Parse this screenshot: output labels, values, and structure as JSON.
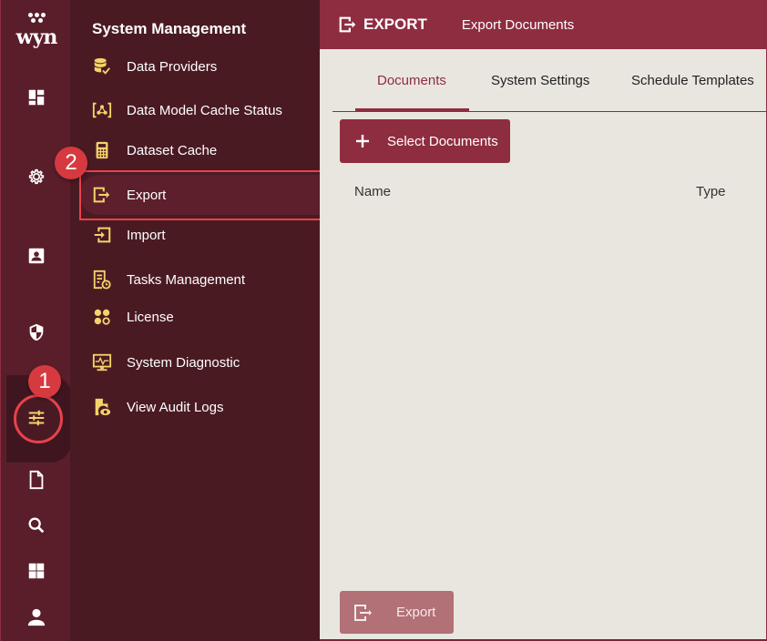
{
  "app": {
    "logo_text": "wyn"
  },
  "rail": {
    "items": [
      {
        "name": "dashboard",
        "icon": "dashboard-icon"
      },
      {
        "name": "settings",
        "icon": "gear-icon"
      },
      {
        "name": "contacts",
        "icon": "contact-card-icon"
      },
      {
        "name": "security",
        "icon": "shield-icon"
      },
      {
        "name": "system-management",
        "icon": "sliders-icon",
        "active": true
      },
      {
        "name": "documents",
        "icon": "document-icon"
      },
      {
        "name": "search",
        "icon": "search-icon"
      },
      {
        "name": "apps",
        "icon": "grid-icon"
      },
      {
        "name": "account",
        "icon": "user-icon"
      }
    ]
  },
  "annotations": {
    "step1": "1",
    "step2": "2"
  },
  "submenu": {
    "title": "System Management",
    "items": [
      {
        "label": "Data Providers",
        "icon": "database-check-icon"
      },
      {
        "label": "Data Model Cache Status",
        "icon": "data-model-icon"
      },
      {
        "label": "Dataset Cache",
        "icon": "calculator-icon"
      },
      {
        "label": "Export",
        "icon": "export-icon",
        "active": true
      },
      {
        "label": "Import",
        "icon": "import-icon"
      },
      {
        "label": "Tasks Management",
        "icon": "task-clock-icon"
      },
      {
        "label": "License",
        "icon": "license-icon"
      },
      {
        "label": "System Diagnostic",
        "icon": "monitor-pulse-icon"
      },
      {
        "label": "View Audit Logs",
        "icon": "file-eye-icon"
      }
    ]
  },
  "header": {
    "title": "EXPORT",
    "subtitle": "Export Documents"
  },
  "tabs": [
    {
      "label": "Documents",
      "active": true
    },
    {
      "label": "System Settings"
    },
    {
      "label": "Schedule Templates"
    }
  ],
  "actions": {
    "select_documents": "Select Documents",
    "export": "Export"
  },
  "table": {
    "columns": [
      "Name",
      "Type"
    ],
    "rows": []
  },
  "colors": {
    "brand": "#8f2d40",
    "rail_bg": "#5a1e2a",
    "submenu_bg": "#4a1a23",
    "content_bg": "#e9e6df",
    "icon_accent": "#f2d46b",
    "annotation": "#d63a40"
  }
}
